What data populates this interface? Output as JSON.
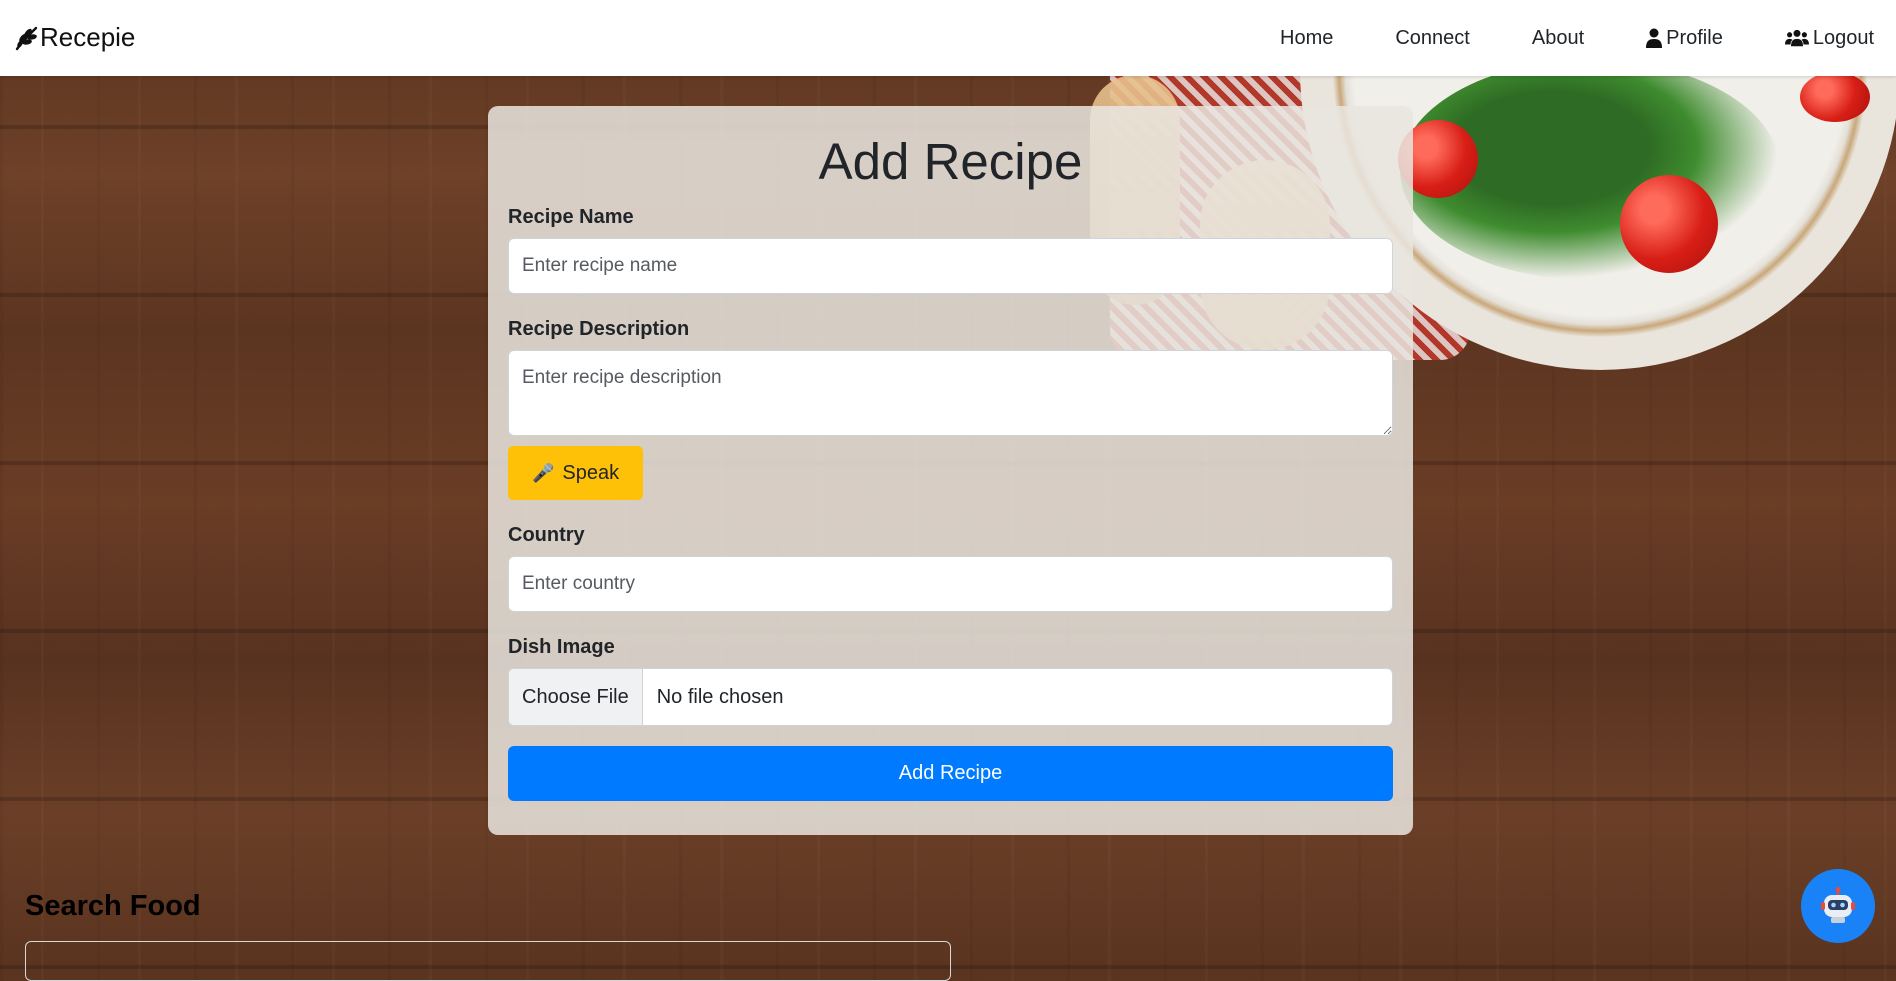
{
  "nav": {
    "brand": "Recepie",
    "brand_icon": "leaf-icon",
    "links": [
      {
        "label": "Home"
      },
      {
        "label": "Connect"
      },
      {
        "label": "About"
      },
      {
        "label": "Profile",
        "icon": "user-icon"
      },
      {
        "label": "Logout",
        "icon": "users-icon"
      }
    ]
  },
  "form": {
    "title": "Add Recipe",
    "name_label": "Recipe Name",
    "name_placeholder": "Enter recipe name",
    "description_label": "Recipe Description",
    "description_placeholder": "Enter recipe description",
    "speak_label": "Speak",
    "speak_icon": "microphone-icon",
    "country_label": "Country",
    "country_placeholder": "Enter country",
    "image_label": "Dish Image",
    "file_button": "Choose File",
    "file_status": "No file chosen",
    "submit_label": "Add Recipe"
  },
  "search": {
    "title": "Search Food"
  },
  "chatbot": {
    "icon": "robot-icon"
  },
  "colors": {
    "primary": "#007bff",
    "warning": "#ffc107",
    "chatbot": "#1a82f7"
  }
}
